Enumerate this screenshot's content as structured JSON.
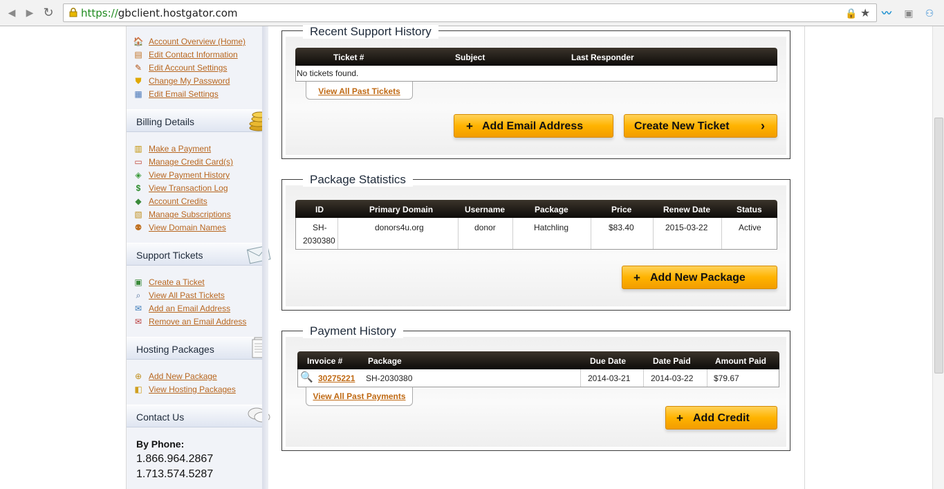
{
  "browser": {
    "url_proto": "https://",
    "url_host": "gbclient.hostgator.com"
  },
  "sidebar": {
    "account_links": [
      {
        "label": "Account Overview (Home)",
        "icon": "home-icon"
      },
      {
        "label": "Edit Contact Information",
        "icon": "contact-card-icon"
      },
      {
        "label": "Edit Account Settings",
        "icon": "pencil-icon"
      },
      {
        "label": "Change My Password",
        "icon": "shield-icon"
      },
      {
        "label": "Edit Email Settings",
        "icon": "email-settings-icon"
      }
    ],
    "billing": {
      "title": "Billing Details",
      "icon": "coins-icon",
      "links": [
        {
          "label": "Make a Payment",
          "icon": "payment-icon"
        },
        {
          "label": "Manage Credit Card(s)",
          "icon": "credit-card-icon"
        },
        {
          "label": "View Payment History",
          "icon": "history-icon"
        },
        {
          "label": "View Transaction Log",
          "icon": "dollar-icon"
        },
        {
          "label": "Account Credits",
          "icon": "credits-icon"
        },
        {
          "label": "Manage Subscriptions",
          "icon": "subscriptions-icon"
        },
        {
          "label": "View Domain Names",
          "icon": "domain-icon"
        }
      ]
    },
    "support": {
      "title": "Support Tickets",
      "icon": "envelope-icon",
      "links": [
        {
          "label": "Create a Ticket",
          "icon": "new-ticket-icon"
        },
        {
          "label": "View All Past Tickets",
          "icon": "search-ticket-icon"
        },
        {
          "label": "Add an Email Address",
          "icon": "add-email-icon"
        },
        {
          "label": "Remove an Email Address",
          "icon": "remove-email-icon"
        }
      ]
    },
    "hosting": {
      "title": "Hosting Packages",
      "icon": "document-stack-icon",
      "links": [
        {
          "label": "Add New Package",
          "icon": "add-package-icon"
        },
        {
          "label": "View Hosting Packages",
          "icon": "package-icon"
        }
      ]
    },
    "contact": {
      "title": "Contact Us",
      "icon": "speech-bubbles-icon",
      "phone_label": "By Phone:",
      "phones": [
        "1.866.964.2867",
        "1.713.574.5287"
      ]
    }
  },
  "support_history": {
    "title": "Recent Support History",
    "columns": [
      "Ticket #",
      "Subject",
      "Last Responder"
    ],
    "empty_text": "No tickets found.",
    "view_all": "View All Past Tickets",
    "add_email_button": "Add Email Address",
    "create_ticket_button": "Create New Ticket"
  },
  "package_stats": {
    "title": "Package Statistics",
    "columns": [
      "ID",
      "Primary Domain",
      "Username",
      "Package",
      "Price",
      "Renew Date",
      "Status"
    ],
    "rows": [
      {
        "id_line1": "SH-",
        "id_line2": "2030380",
        "domain": "donors4u.org",
        "username": "donor",
        "package": "Hatchling",
        "price": "$83.40",
        "renew": "2015-03-22",
        "status": "Active"
      }
    ],
    "add_button": "Add New Package"
  },
  "payment_history": {
    "title": "Payment History",
    "columns": [
      "Invoice #",
      "Package",
      "Due Date",
      "Date Paid",
      "Amount Paid"
    ],
    "rows": [
      {
        "invoice": "30275221",
        "package": "SH-2030380",
        "due": "2014-03-21",
        "paid": "2014-03-22",
        "amount": "$79.67"
      }
    ],
    "view_all": "View All Past Payments",
    "add_credit_button": "Add Credit"
  }
}
